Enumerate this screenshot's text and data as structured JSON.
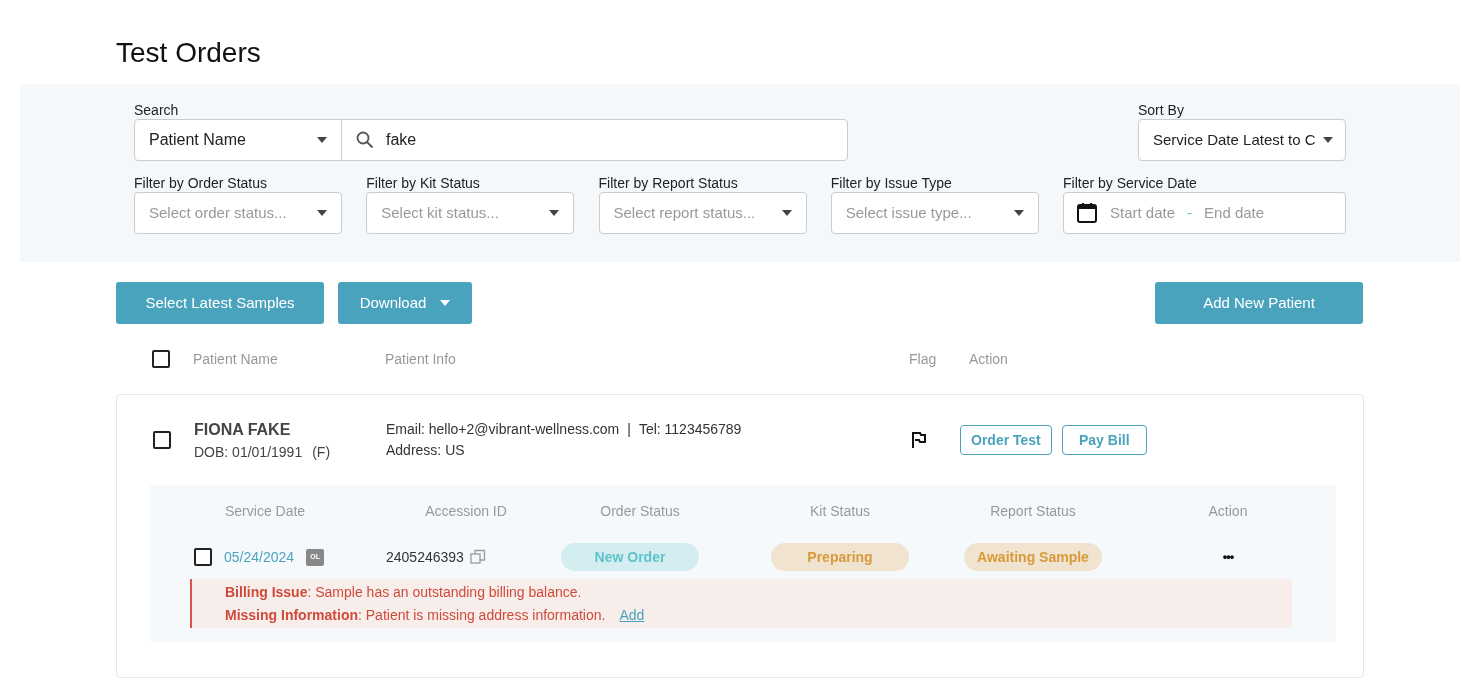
{
  "title": "Test Orders",
  "search": {
    "label": "Search",
    "field": "Patient Name",
    "value": "fake"
  },
  "sort": {
    "label": "Sort By",
    "value": "Service Date Latest to C"
  },
  "filters": [
    {
      "kind": "select",
      "label": "Filter by Order Status",
      "placeholder": "Select order status..."
    },
    {
      "kind": "select",
      "label": "Filter by Kit Status",
      "placeholder": "Select kit status..."
    },
    {
      "kind": "select",
      "label": "Filter by Report Status",
      "placeholder": "Select report status..."
    },
    {
      "kind": "select",
      "label": "Filter by Issue Type",
      "placeholder": "Select issue type..."
    },
    {
      "kind": "daterange",
      "label": "Filter by Service Date",
      "start": "Start date",
      "separator": "-",
      "end": "End date"
    }
  ],
  "buttons": {
    "select_latest": "Select Latest Samples",
    "download": "Download",
    "add_patient": "Add New Patient"
  },
  "table": {
    "select_all_checked": false,
    "columns": [
      "Patient Name",
      "Patient Info",
      "Flag",
      "Action"
    ],
    "patients": [
      {
        "checked": false,
        "name": "FIONA FAKE",
        "dob": "DOB: 01/01/1991",
        "sex": "(F)",
        "email": "Email: hello+2@vibrant-wellness.com",
        "separator": "|",
        "tel": "Tel: 1123456789",
        "address": "Address: US",
        "actions": [
          "Order Test",
          "Pay Bill"
        ],
        "sample_columns": [
          "Service Date",
          "Accession ID",
          "Order Status",
          "Kit Status",
          "Report Status",
          "Action"
        ],
        "samples": [
          {
            "checked": false,
            "date": "05/24/2024",
            "tag": "OL",
            "accession": "2405246393",
            "statuses": [
              {
                "text": "New Order",
                "color": "#5cc4c9"
              },
              {
                "text": "Preparing",
                "color": "#d99a3a"
              },
              {
                "text": "Awaiting Sample",
                "color": "#d99a3a"
              }
            ],
            "more": "•••",
            "issues": [
              {
                "text": "**Billing Issue**: Sample has an outstanding billing balance."
              },
              {
                "text": "**Missing Information**: Patient is missing address information.",
                "link": "Add"
              }
            ]
          }
        ]
      }
    ]
  }
}
